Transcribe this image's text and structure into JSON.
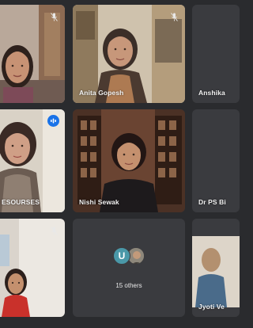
{
  "meeting": {
    "participants": [
      {
        "id": "t1",
        "name": "",
        "muted": true,
        "speaking": false
      },
      {
        "id": "t2",
        "name": "Anita Gopesh",
        "muted": true,
        "speaking": false
      },
      {
        "id": "t3",
        "name": "Anshika",
        "muted": false,
        "speaking": false
      },
      {
        "id": "t4",
        "name": "ESOURSES",
        "muted": false,
        "speaking": true
      },
      {
        "id": "t5",
        "name": "Nishi Sewak",
        "muted": false,
        "speaking": false
      },
      {
        "id": "t6",
        "name": "Dr PS Bi",
        "muted": false,
        "speaking": false
      },
      {
        "id": "t7",
        "name": "",
        "muted": true,
        "speaking": false
      },
      {
        "id": "t8",
        "name": "",
        "muted": false,
        "speaking": false
      },
      {
        "id": "t9",
        "name": "Jyoti Ve",
        "muted": false,
        "speaking": false
      }
    ],
    "others": {
      "avatar_initial": "U",
      "label": "15 others"
    }
  },
  "colors": {
    "background": "#2a2b2e",
    "tile": "#3a3b3f",
    "speaking_indicator": "#1a73e8",
    "active_outline": "#8ab4f8",
    "avatar_u": "#4a98a8"
  },
  "icons": {
    "muted": "mic-off-icon",
    "speaking": "audio-wave-icon"
  }
}
